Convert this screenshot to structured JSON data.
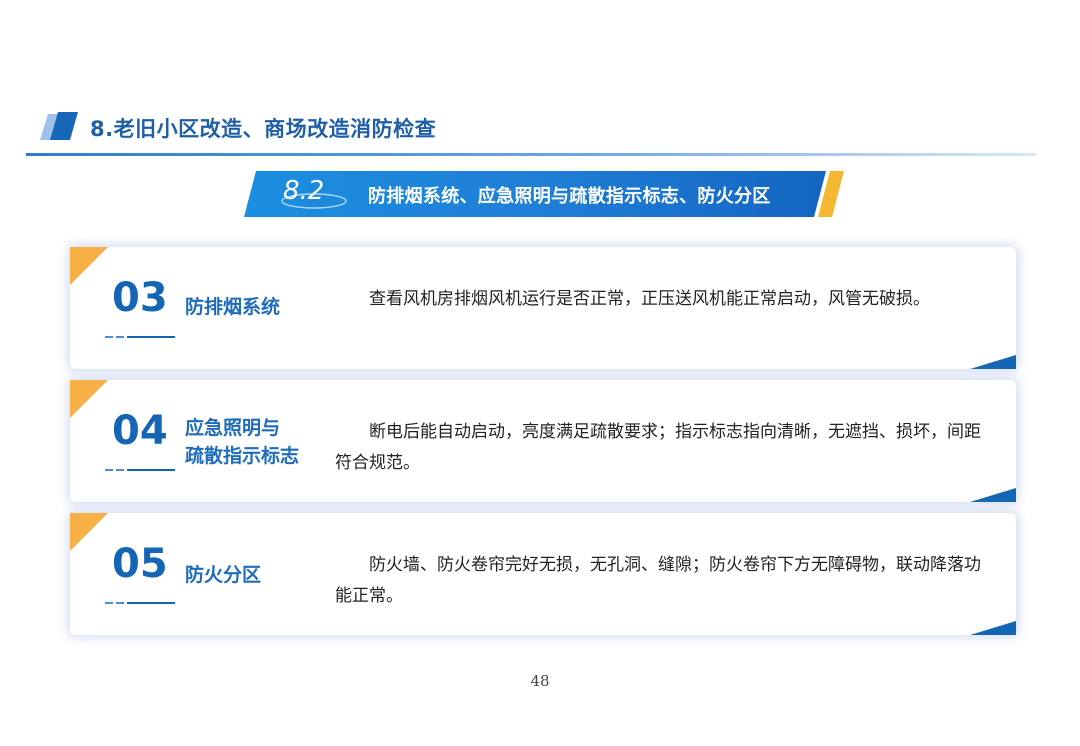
{
  "header": {
    "title": "8.老旧小区改造、商场改造消防检查"
  },
  "banner": {
    "number": "8.2",
    "text": "防排烟系统、应急照明与疏散指示标志、防火分区"
  },
  "cards": [
    {
      "number": "03",
      "label_lines": [
        "防排烟系统"
      ],
      "description": "查看风机房排烟风机运行是否正常，正压送风机能正常启动，风管无破损。"
    },
    {
      "number": "04",
      "label_lines": [
        "应急照明与",
        "疏散指示标志"
      ],
      "description": "断电后能自动启动，亮度满足疏散要求；指示标志指向清晰，无遮挡、损坏，间距符合规范。"
    },
    {
      "number": "05",
      "label_lines": [
        "防火分区"
      ],
      "description": "防火墙、防火卷帘完好无损，无孔洞、缝隙；防火卷帘下方无障碍物，联动降落功能正常。"
    }
  ],
  "page_number": "48",
  "colors": {
    "primary_blue": "#1466b4",
    "accent_yellow": "#f5b731",
    "corner_orange": "#f7b046"
  }
}
